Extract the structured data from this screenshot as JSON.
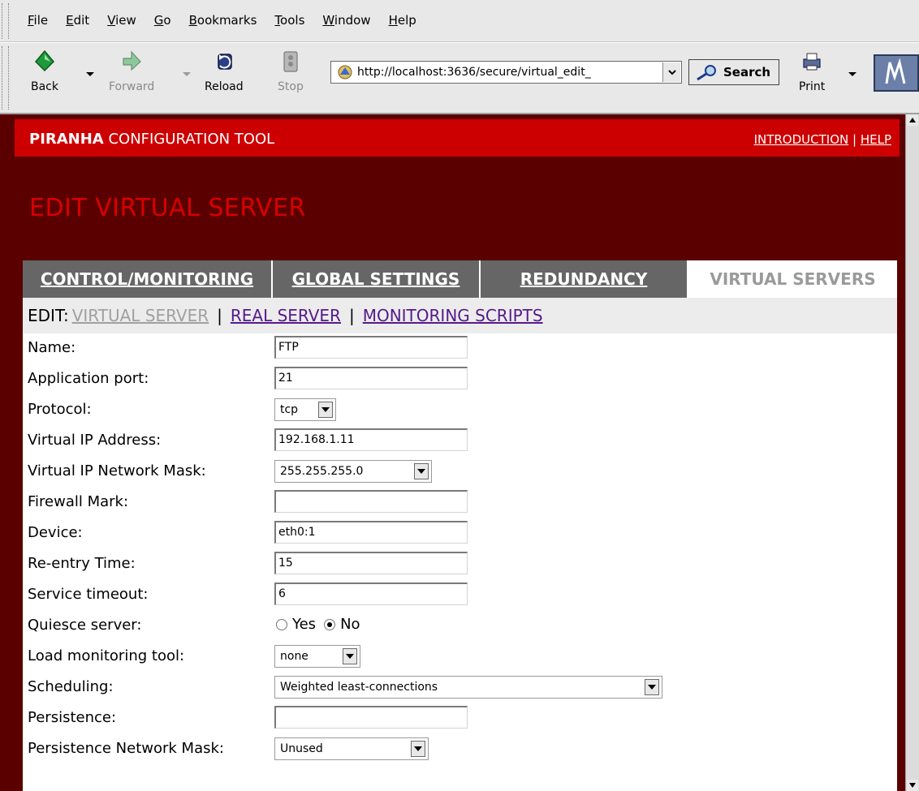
{
  "menubar": {
    "items": [
      {
        "accel": "F",
        "rest": "ile"
      },
      {
        "accel": "E",
        "rest": "dit"
      },
      {
        "accel": "V",
        "rest": "iew"
      },
      {
        "accel": "G",
        "rest": "o"
      },
      {
        "accel": "B",
        "rest": "ookmarks"
      },
      {
        "accel": "T",
        "rest": "ools"
      },
      {
        "accel": "W",
        "rest": "indow"
      },
      {
        "accel": "H",
        "rest": "elp"
      }
    ]
  },
  "toolbar": {
    "back_label": "Back",
    "forward_label": "Forward",
    "reload_label": "Reload",
    "stop_label": "Stop",
    "url": "http://localhost:3636/secure/virtual_edit_",
    "search_label": "Search",
    "print_label": "Print"
  },
  "brand": {
    "title_bold": "PIRANHA",
    "title_rest": " CONFIGURATION TOOL",
    "link_intro": "INTRODUCTION",
    "link_sep": " | ",
    "link_help": "HELP"
  },
  "page_heading": "EDIT VIRTUAL SERVER",
  "tabs": [
    {
      "label": "CONTROL/MONITORING"
    },
    {
      "label": "GLOBAL SETTINGS"
    },
    {
      "label": "REDUNDANCY"
    },
    {
      "label": "VIRTUAL SERVERS"
    }
  ],
  "subnav": {
    "prefix": "EDIT:",
    "current": "VIRTUAL SERVER",
    "sep": "|",
    "real_server": "REAL SERVER",
    "monitoring_scripts": "MONITORING SCRIPTS"
  },
  "form": {
    "name": {
      "label": "Name:",
      "value": "FTP"
    },
    "app_port": {
      "label": "Application port:",
      "value": "21"
    },
    "protocol": {
      "label": "Protocol:",
      "value": "tcp"
    },
    "vip": {
      "label": "Virtual IP Address:",
      "value": "192.168.1.11"
    },
    "vip_mask": {
      "label": "Virtual IP Network Mask:",
      "value": "255.255.255.0"
    },
    "fw_mark": {
      "label": "Firewall Mark:",
      "value": ""
    },
    "device": {
      "label": "Device:",
      "value": "eth0:1"
    },
    "reentry": {
      "label": "Re-entry Time:",
      "value": "15"
    },
    "svc_timeout": {
      "label": "Service timeout:",
      "value": "6"
    },
    "quiesce": {
      "label": "Quiesce server:",
      "yes": "Yes",
      "no": "No",
      "selected": "No"
    },
    "load_mon": {
      "label": "Load monitoring tool:",
      "value": "none"
    },
    "scheduling": {
      "label": "Scheduling:",
      "value": "Weighted least-connections"
    },
    "persistence": {
      "label": "Persistence:",
      "value": ""
    },
    "persist_mask": {
      "label": "Persistence Network Mask:",
      "value": "Unused"
    }
  },
  "colors": {
    "brand_red": "#cc0000",
    "page_bg": "#5b0000",
    "heading_red": "#d80000",
    "tab_gray": "#666666"
  }
}
